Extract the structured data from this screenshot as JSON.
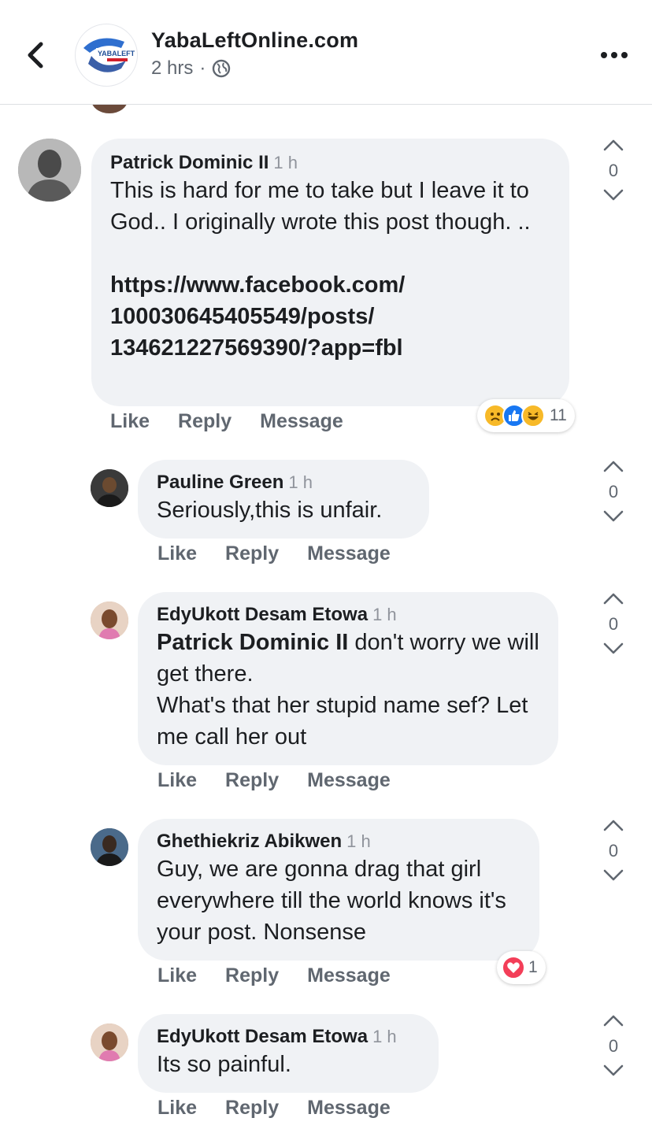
{
  "header": {
    "page_name": "YabaLeftOnline.com",
    "time": "2 hrs",
    "separator": "·",
    "logo_text": "YABALEFT"
  },
  "comments": [
    {
      "author": "Patrick Dominic II",
      "time": "1 h",
      "text_lines": "This is hard for me to take but I leave it to God.. I originally wrote this post though. ..",
      "link": "https://www.facebook.com/\n100030645405549/posts/\n134621227569390/?app=fbl",
      "actions": [
        "Like",
        "Reply",
        "Message"
      ],
      "votes": "0",
      "reaction_count": "11",
      "reaction_icons": [
        "sad-icon",
        "like-icon",
        "haha-icon"
      ]
    },
    {
      "author": "Pauline Green",
      "time": "1 h",
      "text": "Seriously,this is unfair.",
      "actions": [
        "Like",
        "Reply",
        "Message"
      ],
      "votes": "0"
    },
    {
      "author": "EdyUkott Desam Etowa",
      "time": "1 h",
      "mention": "Patrick Dominic II",
      "text": " don't worry we will get there.\nWhat's that her stupid name sef? Let me call her out",
      "actions": [
        "Like",
        "Reply",
        "Message"
      ],
      "votes": "0"
    },
    {
      "author": "Ghethiekriz Abikwen",
      "time": "1 h",
      "text": "Guy, we are gonna drag that girl everywhere till the world knows it's your post. Nonsense",
      "actions": [
        "Like",
        "Reply",
        "Message"
      ],
      "votes": "0",
      "reaction_count": "1",
      "reaction_icons": [
        "love-icon"
      ]
    },
    {
      "author": "EdyUkott Desam Etowa",
      "time": "1 h",
      "text": "Its so painful.",
      "actions": [
        "Like",
        "Reply",
        "Message"
      ],
      "votes": "0"
    }
  ],
  "colors": {
    "bubble": "#f0f2f5",
    "meta": "#606770",
    "like": "#1877f2",
    "love": "#f33e58",
    "haha": "#f7b928"
  }
}
